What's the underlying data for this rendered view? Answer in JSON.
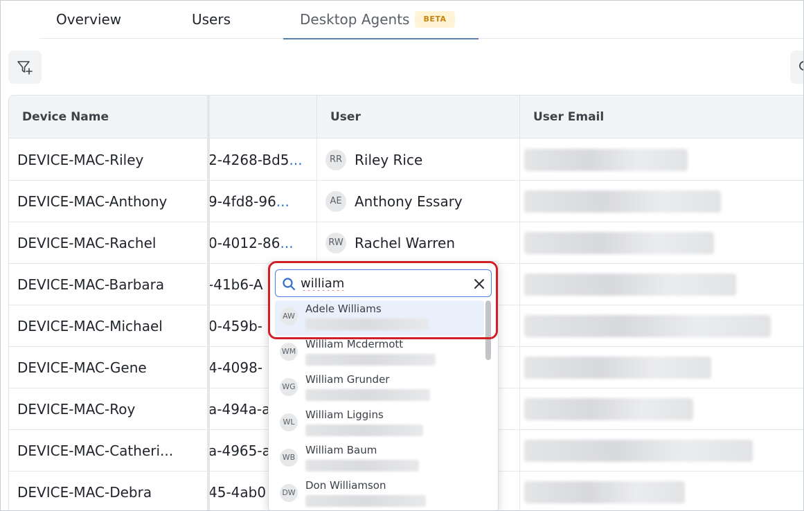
{
  "tabs": [
    {
      "label": "Overview"
    },
    {
      "label": "Users"
    },
    {
      "label": "Desktop Agents",
      "badge": "BETA",
      "active": true
    }
  ],
  "toolbar": {
    "filter_icon": "filter-add-icon"
  },
  "table": {
    "columns": {
      "device": "Device Name",
      "id": "",
      "user": "User",
      "email": "User Email"
    },
    "rows": [
      {
        "device": "DEVICE-MAC-Riley",
        "id": "2-4268-Bd5",
        "id_more": "...",
        "initials": "RR",
        "user": "Riley Rice"
      },
      {
        "device": "DEVICE-MAC-Anthony",
        "id": "9-4fd8-96",
        "id_more": "...",
        "initials": "AE",
        "user": "Anthony Essary"
      },
      {
        "device": "DEVICE-MAC-Rachel",
        "id": "0-4012-86",
        "id_more": "...",
        "initials": "RW",
        "user": "Rachel Warren"
      },
      {
        "device": "DEVICE-MAC-Barbara",
        "id": "-41b6-A",
        "id_more": "",
        "initials": "",
        "user": ""
      },
      {
        "device": "DEVICE-MAC-Michael",
        "id": "0-459b-",
        "id_more": "",
        "initials": "",
        "user": ""
      },
      {
        "device": "DEVICE-MAC-Gene",
        "id": "4-4098-",
        "id_more": "",
        "initials": "",
        "user": ""
      },
      {
        "device": "DEVICE-MAC-Roy",
        "id": "a-494a-a",
        "id_more": "",
        "initials": "",
        "user": ""
      },
      {
        "device": "DEVICE-MAC-Catheri...",
        "id": "a-4965-a",
        "id_more": "",
        "initials": "",
        "user": ""
      },
      {
        "device": "DEVICE-MAC-Debra",
        "id": "45-4ab0",
        "id_more": "",
        "initials": "",
        "user": ""
      }
    ]
  },
  "dropdown": {
    "search_value": "william",
    "options": [
      {
        "initials": "AW",
        "name": "Adele Williams",
        "selected": true
      },
      {
        "initials": "WM",
        "name": "William Mcdermott"
      },
      {
        "initials": "WG",
        "name": "William Grunder"
      },
      {
        "initials": "WL",
        "name": "William Liggins"
      },
      {
        "initials": "WB",
        "name": "William Baum"
      },
      {
        "initials": "DW",
        "name": "Don Williamson"
      }
    ]
  },
  "colors": {
    "accent": "#4f7ddc",
    "highlight": "#d01f26",
    "badge_bg": "#fff4d6",
    "badge_text": "#c7830b"
  }
}
